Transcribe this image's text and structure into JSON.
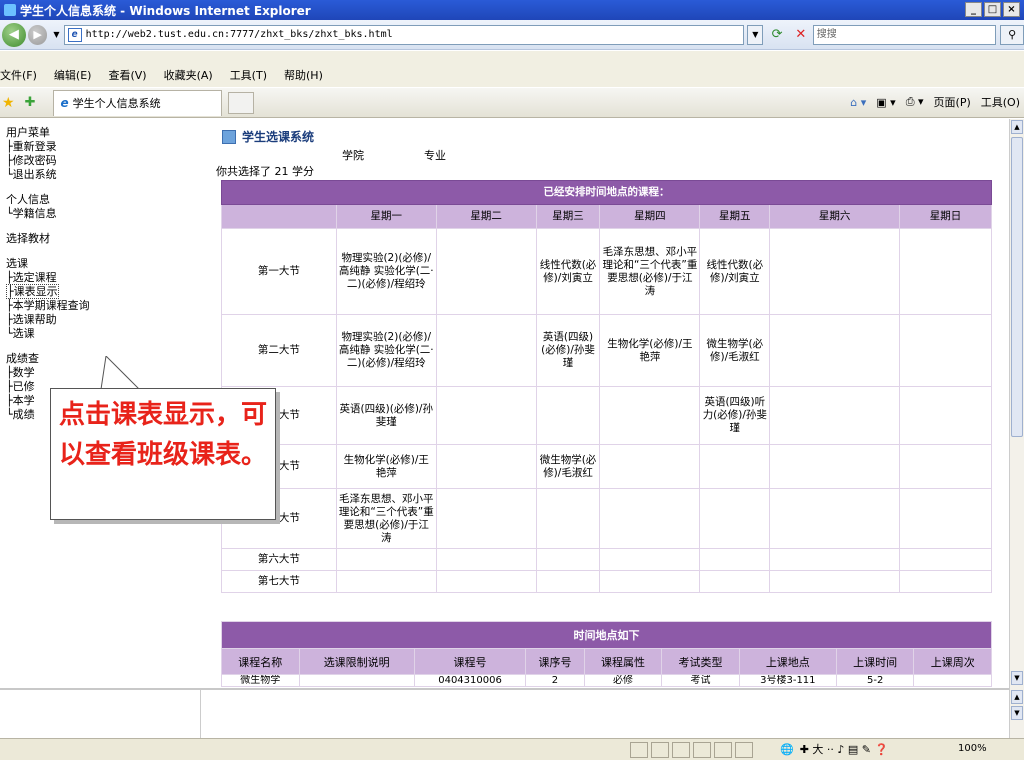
{
  "window": {
    "title": "学生个人信息系统 - Windows Internet Explorer",
    "min": "_",
    "max": "□",
    "close": "×"
  },
  "address": {
    "url": "http://web2.tust.edu.cn:7777/zhxt_bks/zhxt_bks.html",
    "search_placeholder": "搜搜"
  },
  "menu": [
    "文件(F)",
    "编辑(E)",
    "查看(V)",
    "收藏夹(A)",
    "工具(T)",
    "帮助(H)"
  ],
  "tab": {
    "label": "学生个人信息系统"
  },
  "favtools": {
    "page": "页面(P)",
    "tools": "工具(O)"
  },
  "sidebar": {
    "groups": [
      {
        "head": "用户菜单",
        "items": [
          "├重新登录",
          "├修改密码",
          "└退出系统"
        ]
      },
      {
        "head": "个人信息",
        "items": [
          "└学籍信息"
        ]
      },
      {
        "head": "选择教材",
        "items": []
      },
      {
        "head": "选课",
        "items": [
          "├选定课程",
          "├课表显示",
          "├本学期课程查询",
          "├选课帮助",
          "└选课"
        ]
      },
      {
        "head": "成绩查",
        "items": [
          "├数学",
          "├已修",
          "├本学",
          "└成绩"
        ]
      }
    ]
  },
  "main": {
    "title": "学生选课系统",
    "college_label": "学院",
    "major_label": "专业",
    "credits": "你共选择了 21 学分"
  },
  "schedule": {
    "caption": "已经安排时间地点的课程：",
    "days": [
      "星期一",
      "星期二",
      "星期三",
      "星期四",
      "星期五",
      "星期六",
      "星期日"
    ],
    "rows": [
      {
        "slot": "第一大节",
        "cells": [
          "物理实验(2)(必修)/高纯静 实验化学(二·二)(必修)/程绍玲",
          "",
          "线性代数(必修)/刘寅立",
          "毛泽东思想、邓小平理论和“三个代表”重要思想(必修)/于江涛",
          "线性代数(必修)/刘寅立",
          "",
          ""
        ]
      },
      {
        "slot": "第二大节",
        "cells": [
          "物理实验(2)(必修)/高纯静 实验化学(二·二)(必修)/程绍玲",
          "",
          "英语(四级)(必修)/孙斐瑾",
          "生物化学(必修)/王艳萍",
          "微生物学(必修)/毛淑红",
          "",
          ""
        ]
      },
      {
        "slot": "第三大节",
        "cells": [
          "英语(四级)(必修)/孙斐瑾",
          "",
          "",
          "",
          "英语(四级)听力(必修)/孙斐瑾",
          "",
          ""
        ]
      },
      {
        "slot": "第四大节",
        "cells": [
          "生物化学(必修)/王艳萍",
          "",
          "微生物学(必修)/毛淑红",
          "",
          "",
          "",
          ""
        ]
      },
      {
        "slot": "第五大节",
        "cells": [
          "毛泽东思想、邓小平理论和“三个代表”重要思想(必修)/于江涛",
          "",
          "",
          "",
          "",
          "",
          ""
        ]
      },
      {
        "slot": "第六大节",
        "cells": [
          "",
          "",
          "",
          "",
          "",
          "",
          ""
        ]
      },
      {
        "slot": "第七大节",
        "cells": [
          "",
          "",
          "",
          "",
          "",
          "",
          ""
        ]
      }
    ]
  },
  "timeloc": {
    "caption": "时间地点如下",
    "headers": [
      "课程名称",
      "选课限制说明",
      "课程号",
      "课序号",
      "课程属性",
      "考试类型",
      "上课地点",
      "上课时间",
      "上课周次"
    ],
    "first_row": [
      "微生物学",
      "",
      "0404310006",
      "2",
      "必修",
      "考试",
      "3号楼3-111",
      "5-2",
      ""
    ]
  },
  "status": {
    "zoom": "100%"
  },
  "callout": {
    "text": "点击课表显示，可以查看班级课表。"
  }
}
